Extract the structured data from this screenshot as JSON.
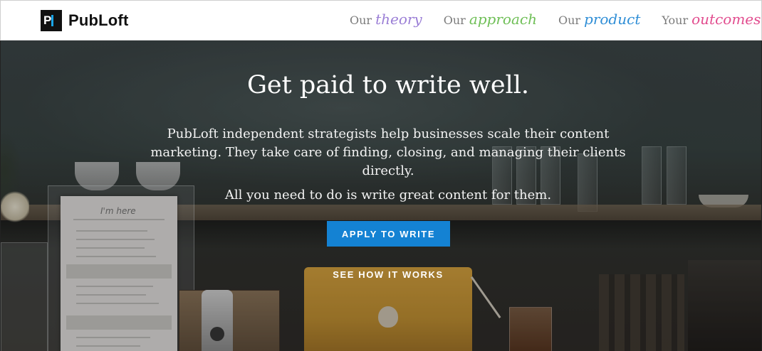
{
  "brand": {
    "name": "PubLoft",
    "logo_letter": "P"
  },
  "nav": [
    {
      "prefix": "Our",
      "accent": "theory",
      "color": "#9b7fd6"
    },
    {
      "prefix": "Our",
      "accent": "approach",
      "color": "#6fbf57"
    },
    {
      "prefix": "Our",
      "accent": "product",
      "color": "#2f8ed6"
    },
    {
      "prefix": "Your",
      "accent": "outcomes",
      "color": "#e24d8f"
    }
  ],
  "hero": {
    "headline": "Get paid to write well.",
    "paragraph": "PubLoft independent strategists help businesses scale their content marketing. They take care of finding, closing, and managing their clients directly.",
    "paragraph2": "All you need to do is write great content for them.",
    "apply_label": "APPLY TO WRITE",
    "how_label": "SEE HOW IT WORKS",
    "menu_card_title": "I'm here"
  },
  "colors": {
    "button": "#1482d3",
    "logo_bar": "#19a4e6"
  }
}
